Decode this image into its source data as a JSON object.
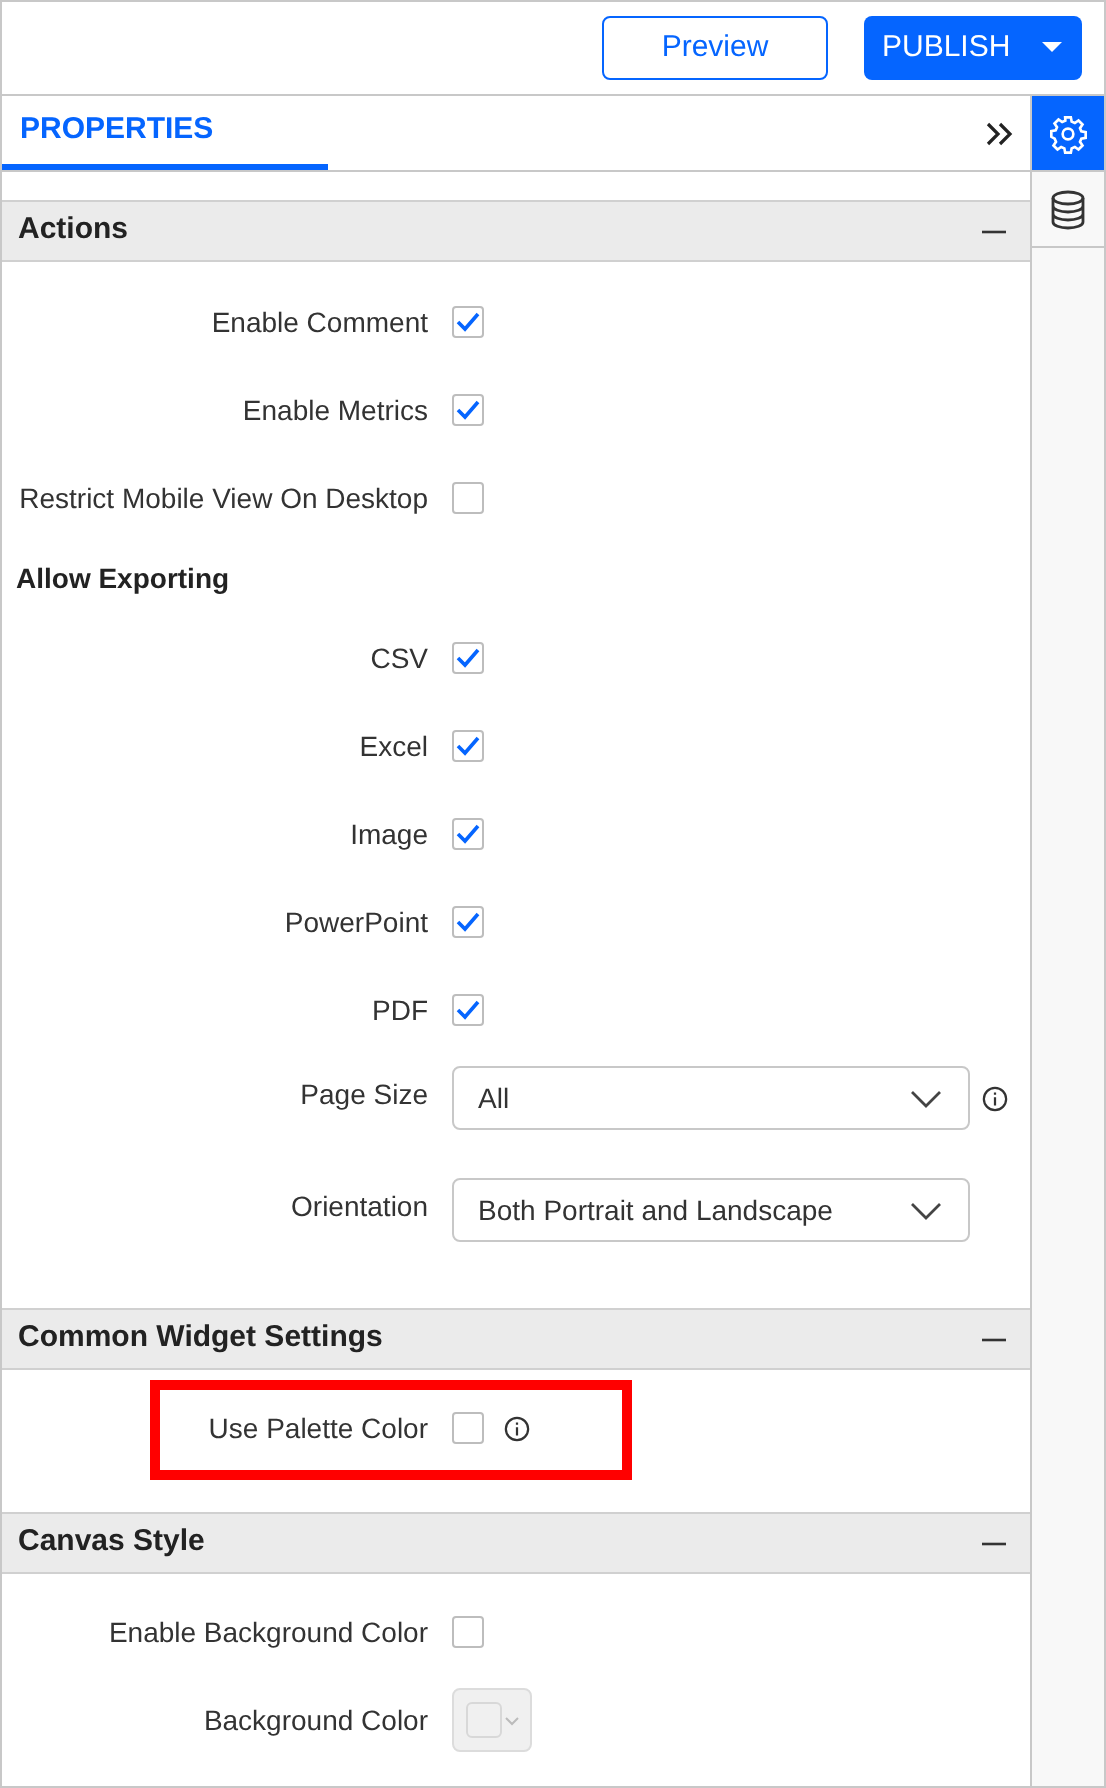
{
  "toolbar": {
    "preview": "Preview",
    "publish": "PUBLISH"
  },
  "panel": {
    "tab": {
      "label": "PROPERTIES",
      "selected": true
    },
    "rail": [
      {
        "kind": "gear",
        "selected": true
      },
      {
        "kind": "database",
        "selected": false
      }
    ]
  },
  "sections": [
    {
      "title": "Actions",
      "expanded": true,
      "items": [
        {
          "kind": "checkbox",
          "label": "Enable Comment",
          "checked": true
        },
        {
          "kind": "checkbox",
          "label": "Enable Metrics",
          "checked": true
        },
        {
          "kind": "checkbox",
          "label": "Restrict Mobile View On Desktop",
          "checked": false
        },
        {
          "kind": "heading",
          "label": "Allow Exporting"
        },
        {
          "kind": "checkbox",
          "label": "CSV",
          "checked": true
        },
        {
          "kind": "checkbox",
          "label": "Excel",
          "checked": true
        },
        {
          "kind": "checkbox",
          "label": "Image",
          "checked": true
        },
        {
          "kind": "checkbox",
          "label": "PowerPoint",
          "checked": true
        },
        {
          "kind": "checkbox",
          "label": "PDF",
          "checked": true
        },
        {
          "kind": "dropdown",
          "label": "Page Size",
          "value": "All",
          "info": true
        },
        {
          "kind": "dropdown",
          "label": "Orientation",
          "value": "Both Portrait and Landscape"
        }
      ]
    },
    {
      "title": "Common Widget Settings",
      "expanded": true,
      "items": [
        {
          "kind": "checkbox",
          "label": "Use Palette Color",
          "checked": false,
          "info": true,
          "highlighted": true
        }
      ]
    },
    {
      "title": "Canvas Style",
      "expanded": true,
      "items": [
        {
          "kind": "checkbox",
          "label": "Enable Background Color",
          "checked": false
        },
        {
          "kind": "color",
          "label": "Background Color",
          "disabled": true
        }
      ]
    }
  ]
}
